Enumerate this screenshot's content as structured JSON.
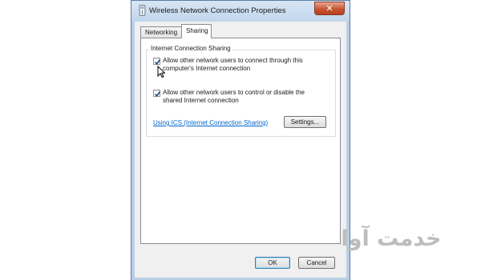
{
  "window": {
    "title": "Wireless Network Connection Properties",
    "close_symbol": "✕"
  },
  "tabs": [
    {
      "label": "Networking",
      "active": false
    },
    {
      "label": "Sharing",
      "active": true
    }
  ],
  "sharing": {
    "group_title": "Internet Connection Sharing",
    "checkbox_allow_connect": {
      "label": "Allow other network users to connect through this computer's Internet connection",
      "checked": true
    },
    "checkbox_allow_control": {
      "label": "Allow other network users to control or disable the shared Internet connection",
      "checked": true
    },
    "link_text": "Using ICS (Internet Connection Sharing)",
    "settings_label": "Settings..."
  },
  "footer": {
    "ok_label": "OK",
    "cancel_label": "Cancel"
  },
  "watermark": {
    "text": "خدمت آوا"
  },
  "colors": {
    "title_bar": "#c1d6ec",
    "close_button": "#c75533",
    "link": "#0066cc",
    "watermark": "#bdbdbd"
  }
}
